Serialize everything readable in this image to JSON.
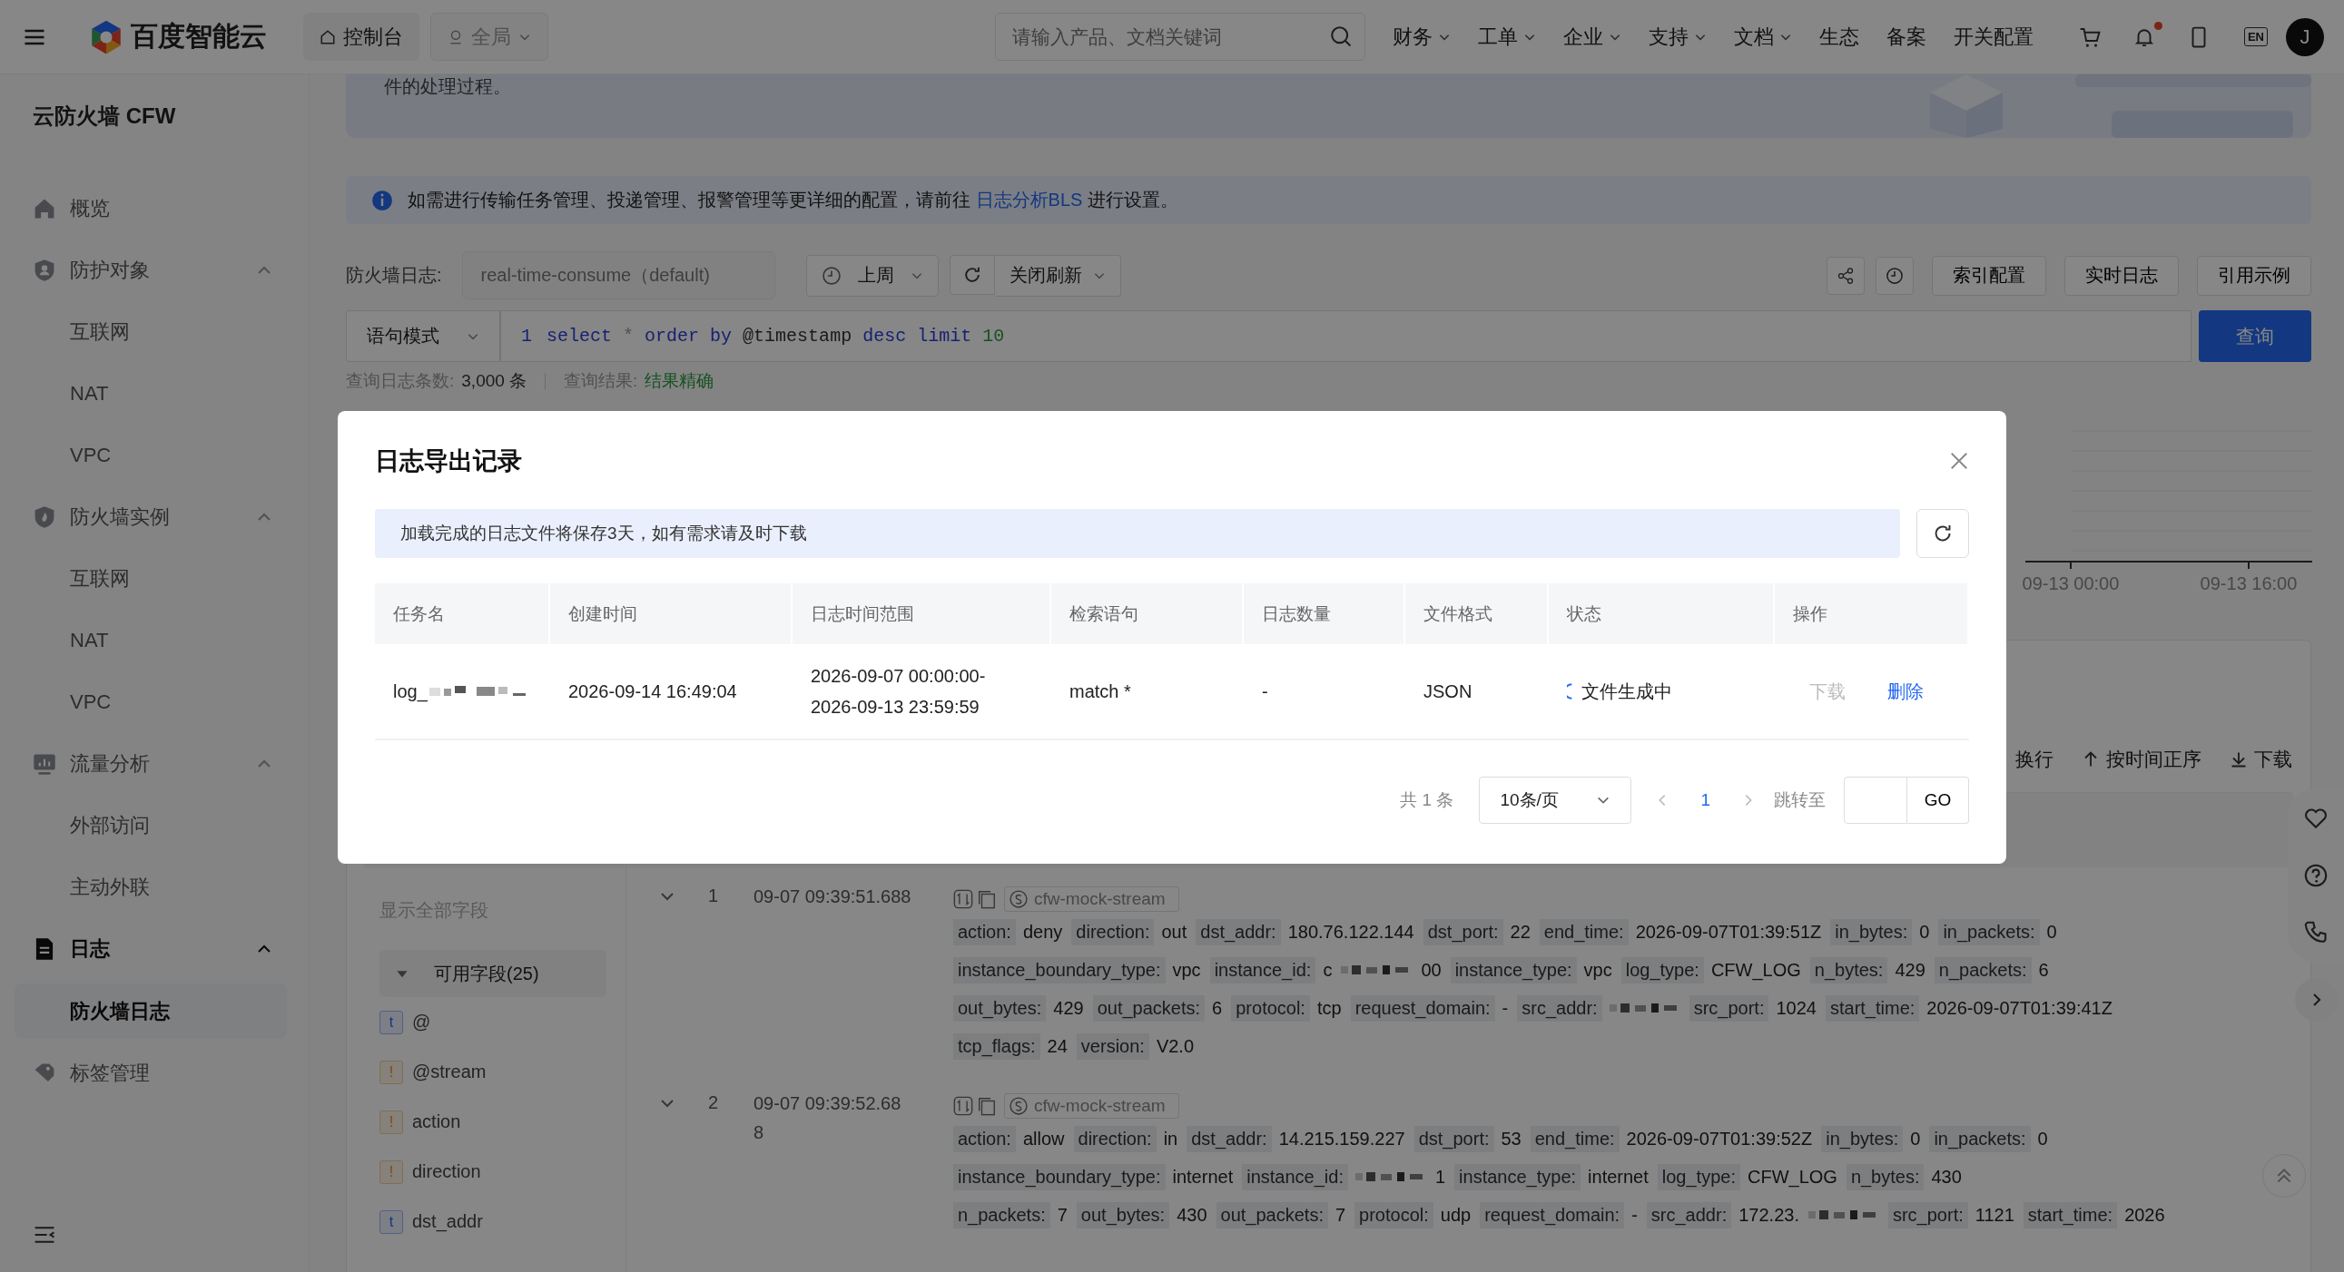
{
  "header": {
    "logo_text": "百度智能云",
    "console_button": "控制台",
    "region_select": "全局",
    "search": {
      "placeholder": "请输入产品、文档关键词"
    },
    "nav": [
      {
        "label": "财务",
        "dropdown": true
      },
      {
        "label": "工单",
        "dropdown": true
      },
      {
        "label": "企业",
        "dropdown": true
      },
      {
        "label": "支持",
        "dropdown": true
      },
      {
        "label": "文档",
        "dropdown": true
      },
      {
        "label": "生态",
        "dropdown": false
      },
      {
        "label": "备案",
        "dropdown": false
      },
      {
        "label": "开关配置",
        "dropdown": false
      }
    ],
    "notification_dot": true,
    "language_button": "EN",
    "avatar": "J"
  },
  "sidebar": {
    "title": "云防火墙 CFW",
    "items": [
      {
        "label": "概览",
        "selected": false
      },
      {
        "label": "防护对象",
        "expanded": true,
        "selected": false,
        "children": [
          {
            "label": "互联网",
            "selected": false
          },
          {
            "label": "NAT",
            "selected": false
          },
          {
            "label": "VPC",
            "selected": false
          }
        ]
      },
      {
        "label": "防火墙实例",
        "expanded": true,
        "selected": false,
        "children": [
          {
            "label": "互联网",
            "selected": false
          },
          {
            "label": "NAT",
            "selected": false
          },
          {
            "label": "VPC",
            "selected": false
          }
        ]
      },
      {
        "label": "流量分析",
        "expanded": true,
        "selected": false,
        "children": [
          {
            "label": "外部访问",
            "selected": false
          },
          {
            "label": "主动外联",
            "selected": false
          }
        ]
      },
      {
        "label": "日志",
        "expanded": true,
        "selected": false,
        "children": [
          {
            "label": "防火墙日志",
            "selected": true
          }
        ]
      },
      {
        "label": "标签管理",
        "selected": false
      }
    ]
  },
  "banner": {
    "text": "件的处理过程。"
  },
  "info_alert": {
    "text_before": "如需进行传输任务管理、投递管理、报警管理等更详细的配置，请前往 ",
    "link": "日志分析BLS",
    "text_after": " 进行设置。"
  },
  "toolbar": {
    "log_label": "防火墙日志:",
    "logstore_select": "real-time-consume（default)",
    "time_range_select": "上周",
    "refresh_select": "关闭刷新",
    "buttons": [
      "索引配置",
      "实时日志",
      "引用示例"
    ]
  },
  "query": {
    "mode_select": "语句模式",
    "line_number": "1",
    "tokens": [
      {
        "text": "select",
        "kind": "keyword"
      },
      {
        "text": "*",
        "kind": "operator"
      },
      {
        "text": "order by",
        "kind": "keyword"
      },
      {
        "text": "@timestamp",
        "kind": "plain"
      },
      {
        "text": "desc",
        "kind": "keyword"
      },
      {
        "text": "limit",
        "kind": "keyword"
      },
      {
        "text": "10",
        "kind": "number"
      }
    ],
    "submit": "查询"
  },
  "stats": {
    "count_label": "查询日志条数:",
    "count": "3,000 条",
    "result_label": "查询结果:",
    "result": "结果精确"
  },
  "chart": {
    "x_labels": [
      "09-13 00:00",
      "09-13 16:00"
    ]
  },
  "log_toolbar": [
    {
      "label": "换行"
    },
    {
      "label": "按时间正序"
    },
    {
      "label": "下载"
    }
  ],
  "fields_panel": {
    "show_all": "显示全部字段",
    "available": "可用字段(25)",
    "expanded": true,
    "fields": [
      {
        "type_mark": "t",
        "kind": "text",
        "name": "@"
      },
      {
        "type_mark": "!",
        "kind": "unknown",
        "name": "@stream"
      },
      {
        "type_mark": "!",
        "kind": "unknown",
        "name": "action"
      },
      {
        "type_mark": "!",
        "kind": "unknown",
        "name": "direction"
      },
      {
        "type_mark": "t",
        "kind": "text",
        "name": "dst_addr"
      }
    ]
  },
  "logs": [
    {
      "index": "1",
      "time_lines": [
        "09-07 09:39:51.688"
      ],
      "stream": "cfw-mock-stream",
      "lines": [
        [
          {
            "key": "action:",
            "value": "deny"
          },
          {
            "key": "direction:",
            "value": "out"
          },
          {
            "key": "dst_addr:",
            "value": "180.76.122.144"
          },
          {
            "key": "dst_port:",
            "value": "22"
          },
          {
            "key": "end_time:",
            "value": "2026-09-07T01:39:51Z"
          },
          {
            "key": "in_bytes:",
            "value": "0"
          },
          {
            "key": "in_packets:",
            "value": "0"
          }
        ],
        [
          {
            "key": "instance_boundary_type:",
            "value": "vpc"
          },
          {
            "key": "instance_id:",
            "value": "c",
            "redacted": true,
            "value_end": "00"
          },
          {
            "key": "instance_type:",
            "value": "vpc"
          },
          {
            "key": "log_type:",
            "value": "CFW_LOG"
          },
          {
            "key": "n_bytes:",
            "value": "429"
          },
          {
            "key": "n_packets:",
            "value": "6"
          }
        ],
        [
          {
            "key": "out_bytes:",
            "value": "429"
          },
          {
            "key": "out_packets:",
            "value": "6"
          },
          {
            "key": "protocol:",
            "value": "tcp"
          },
          {
            "key": "request_domain:",
            "value": "-"
          },
          {
            "key": "src_addr:",
            "redacted": true
          },
          {
            "key": "src_port:",
            "value": "1024"
          },
          {
            "key": "start_time:",
            "value": "2026-09-07T01:39:41Z"
          }
        ],
        [
          {
            "key": "tcp_flags:",
            "value": "24"
          },
          {
            "key": "version:",
            "value": "V2.0"
          }
        ]
      ]
    },
    {
      "index": "2",
      "time_lines": [
        "09-07 09:39:52.68",
        "8"
      ],
      "stream": "cfw-mock-stream",
      "lines": [
        [
          {
            "key": "action:",
            "value": "allow"
          },
          {
            "key": "direction:",
            "value": "in"
          },
          {
            "key": "dst_addr:",
            "value": "14.215.159.227"
          },
          {
            "key": "dst_port:",
            "value": "53"
          },
          {
            "key": "end_time:",
            "value": "2026-09-07T01:39:52Z"
          },
          {
            "key": "in_bytes:",
            "value": "0"
          },
          {
            "key": "in_packets:",
            "value": "0"
          }
        ],
        [
          {
            "key": "instance_boundary_type:",
            "value": "internet"
          },
          {
            "key": "instance_id:",
            "redacted": true,
            "value_end": "1"
          },
          {
            "key": "instance_type:",
            "value": "internet"
          },
          {
            "key": "log_type:",
            "value": "CFW_LOG"
          },
          {
            "key": "n_bytes:",
            "value": "430"
          }
        ],
        [
          {
            "key": "n_packets:",
            "value": "7"
          },
          {
            "key": "out_bytes:",
            "value": "430"
          },
          {
            "key": "out_packets:",
            "value": "7"
          },
          {
            "key": "protocol:",
            "value": "udp"
          },
          {
            "key": "request_domain:",
            "value": "-"
          },
          {
            "key": "src_addr:",
            "value": "172.23.",
            "redacted": true
          },
          {
            "key": "src_port:",
            "value": "1121"
          },
          {
            "key": "start_time:",
            "value": "2026"
          }
        ]
      ]
    }
  ],
  "export_dialog": {
    "title": "日志导出记录",
    "notice": "加载完成的日志文件将保存3天，如有需求请及时下载",
    "columns": [
      "任务名",
      "创建时间",
      "日志时间范围",
      "检索语句",
      "日志数量",
      "文件格式",
      "状态",
      "操作"
    ],
    "rows": [
      {
        "task_name": "log_",
        "redacted": true,
        "created": "2026-09-14 16:49:04",
        "range_lines": [
          "2026-09-07 00:00:00-",
          "2026-09-13 23:59:59"
        ],
        "query": "match *",
        "count": "-",
        "format": "JSON",
        "status": "文件生成中",
        "actions": [
          {
            "label": "下载",
            "disabled": true
          },
          {
            "label": "删除",
            "disabled": false
          }
        ]
      }
    ],
    "pagination": {
      "total": "共 1 条",
      "page_size": "10条/页",
      "pages": [
        {
          "label": "1",
          "selected": true
        }
      ],
      "jump_label": "跳转至",
      "go": "GO"
    }
  }
}
